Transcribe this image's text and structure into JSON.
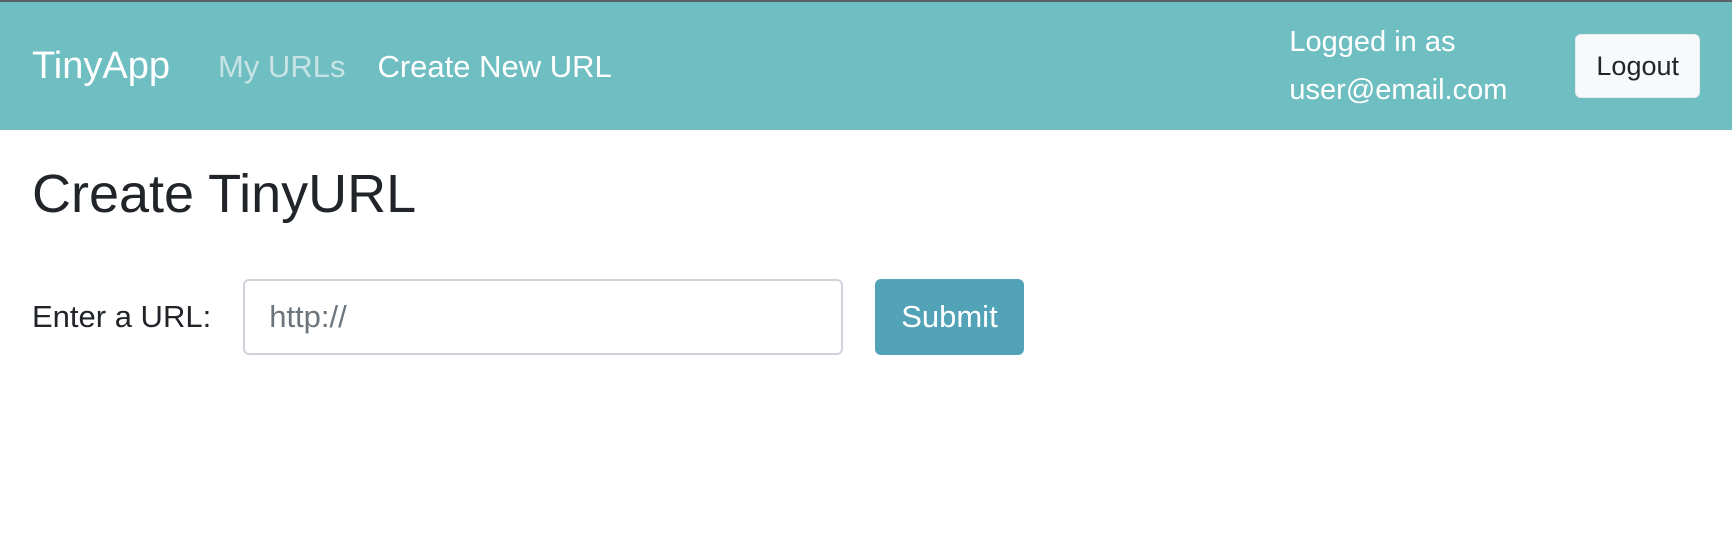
{
  "navbar": {
    "brand": "TinyApp",
    "links": [
      {
        "label": "My URLs",
        "active": true
      },
      {
        "label": "Create New URL",
        "active": false
      }
    ],
    "user_line1": "Logged in as",
    "user_line2": "user@email.com",
    "logout_label": "Logout",
    "background_color": "#6fbfc2"
  },
  "main": {
    "title": "Create TinyURL",
    "form": {
      "label": "Enter a URL:",
      "input_placeholder": "http://",
      "input_value": "",
      "submit_label": "Submit",
      "submit_color": "#52a3b7"
    }
  }
}
